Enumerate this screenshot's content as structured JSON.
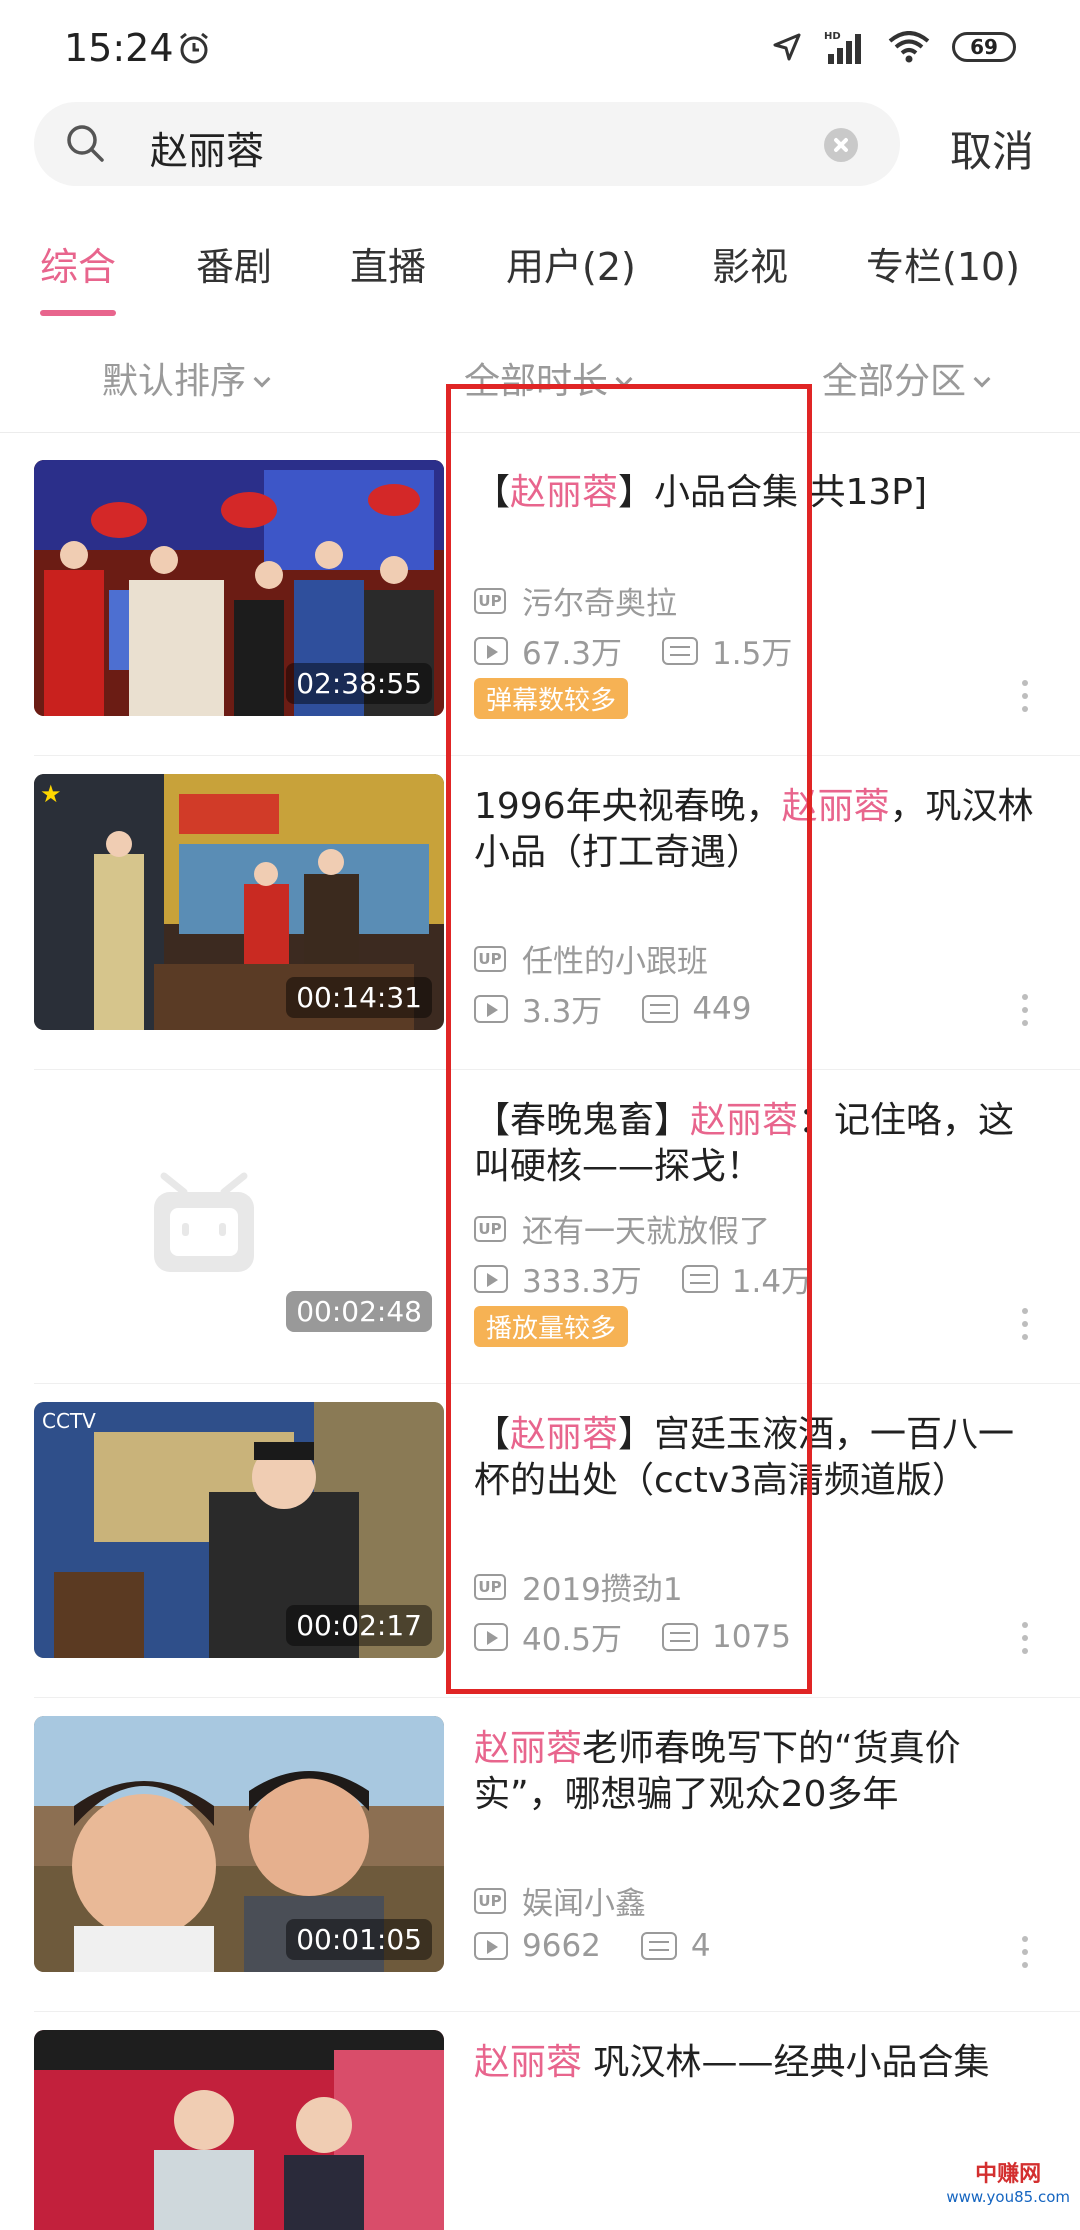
{
  "status_bar": {
    "time": "15:24",
    "battery": "69",
    "network": "HD"
  },
  "search": {
    "query": "赵丽蓉",
    "cancel_label": "取消"
  },
  "tabs": [
    {
      "label": "综合",
      "active": true
    },
    {
      "label": "番剧"
    },
    {
      "label": "直播"
    },
    {
      "label": "用户(2)"
    },
    {
      "label": "影视"
    },
    {
      "label": "专栏(10)"
    }
  ],
  "filters": [
    {
      "label": "默认排序"
    },
    {
      "label": "全部时长"
    },
    {
      "label": "全部分区"
    }
  ],
  "results": [
    {
      "duration": "02:38:55",
      "title_parts": [
        "【",
        "赵丽蓉",
        "】小品合集 共13P]"
      ],
      "uploader": "污尔奇奥拉",
      "plays": "67.3万",
      "danmaku": "1.5万",
      "badge": "弹幕数较多"
    },
    {
      "duration": "00:14:31",
      "title_parts": [
        "1996年央视春晚，",
        "赵丽蓉",
        "，巩汉林小品（打工奇遇）"
      ],
      "uploader": "任性的小跟班",
      "plays": "3.3万",
      "danmaku": "449"
    },
    {
      "duration": "00:02:48",
      "title_parts": [
        "【春晚鬼畜】",
        "赵丽蓉",
        "：记住咯，这叫硬核——探戈！"
      ],
      "uploader": "还有一天就放假了",
      "plays": "333.3万",
      "danmaku": "1.4万",
      "badge": "播放量较多"
    },
    {
      "duration": "00:02:17",
      "title_parts": [
        "【",
        "赵丽蓉",
        "】宫廷玉液酒，一百八一杯的出处（cctv3高清频道版）"
      ],
      "uploader": "2019攒劲1",
      "plays": "40.5万",
      "danmaku": "1075"
    },
    {
      "duration": "00:01:05",
      "title_parts": [
        "",
        "赵丽蓉",
        "老师春晚写下的“货真价实”，哪想骗了观众20多年"
      ],
      "uploader": "娱闻小鑫",
      "plays": "9662",
      "danmaku": "4"
    },
    {
      "title_parts": [
        "",
        "赵丽蓉",
        " 巩汉林——经典小品合集"
      ]
    }
  ],
  "watermark": {
    "line1": "中赚网",
    "line2": "www.you85.com"
  },
  "colors": {
    "accent": "#e8658d",
    "badge": "#f6b254",
    "highlight_box": "#e02525"
  }
}
